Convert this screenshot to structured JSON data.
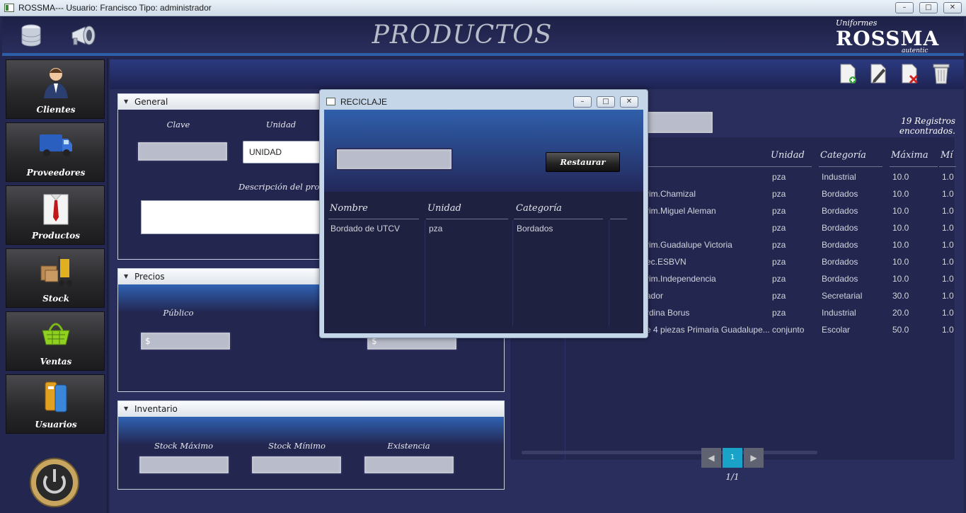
{
  "window": {
    "title": "ROSSMA--- Usuario: Francisco  Tipo: administrador",
    "controls": [
      "–",
      "□",
      "✕"
    ]
  },
  "header": {
    "title": "PRODUCTOS",
    "logo_line1": "Uniformes",
    "logo_line2": "ROSSMA",
    "logo_line3": "autentic"
  },
  "sidebar": {
    "items": [
      {
        "label": "Clientes"
      },
      {
        "label": "Proveedores"
      },
      {
        "label": "Productos"
      },
      {
        "label": "Stock"
      },
      {
        "label": "Ventas"
      },
      {
        "label": "Usuarios"
      }
    ]
  },
  "general": {
    "header": "General",
    "clave_label": "Clave",
    "unidad_label": "Unidad",
    "unidad_value": "UNIDAD",
    "descripcion_label": "Descripción del prod"
  },
  "precios": {
    "header": "Precios",
    "publico_label": "Público",
    "currency_symbol": "$"
  },
  "inventario": {
    "header": "Inventario",
    "stock_max_label": "Stock Máximo",
    "stock_min_label": "Stock Mínimo",
    "existencia_label": "Existencia"
  },
  "results": {
    "count_text": "19 Registros encontrados.",
    "columns": [
      "Unidad",
      "Categoría",
      "Máxima",
      "Mí"
    ],
    "rows": [
      {
        "nombre": "",
        "unidad": "pza",
        "categoria": "Industrial",
        "maxima": "10.0",
        "min": "1.0"
      },
      {
        "nombre": "rim.Chamizal",
        "unidad": "pza",
        "categoria": "Bordados",
        "maxima": "10.0",
        "min": "1.0"
      },
      {
        "nombre": "rim.Miguel Aleman",
        "unidad": "pza",
        "categoria": "Bordados",
        "maxima": "10.0",
        "min": "1.0"
      },
      {
        "nombre": "",
        "unidad": "pza",
        "categoria": "Bordados",
        "maxima": "10.0",
        "min": "1.0"
      },
      {
        "nombre": "rim.Guadalupe Victoria",
        "unidad": "pza",
        "categoria": "Bordados",
        "maxima": "10.0",
        "min": "1.0"
      },
      {
        "nombre": "ec.ESBVN",
        "unidad": "pza",
        "categoria": "Bordados",
        "maxima": "10.0",
        "min": "1.0"
      },
      {
        "nombre": "rim.Independencia",
        "unidad": "pza",
        "categoria": "Bordados",
        "maxima": "10.0",
        "min": "1.0"
      },
      {
        "nombre": "ador",
        "unidad": "pza",
        "categoria": "Secretarial",
        "maxima": "30.0",
        "min": "1.0"
      },
      {
        "nombre": "rdina Borus",
        "unidad": "pza",
        "categoria": "Industrial",
        "maxima": "20.0",
        "min": "1.0"
      },
      {
        "nombre": "e 4 piezas Primaria Guadalupe...",
        "unidad": "conjunto",
        "categoria": "Escolar",
        "maxima": "50.0",
        "min": "1.0"
      }
    ]
  },
  "pager": {
    "prev": "◀",
    "current": "1",
    "next": "▶",
    "info": "1/1"
  },
  "modal": {
    "title": "RECICLAJE",
    "restore_label": "Restaurar",
    "columns": [
      "Nombre",
      "Unidad",
      "Categoría"
    ],
    "rows": [
      {
        "nombre": "Bordado de UTCV",
        "unidad": "pza",
        "categoria": "Bordados"
      }
    ]
  },
  "colors": {
    "background": "#23264f",
    "accent": "#2c5fa7",
    "pager_active": "#1aa3c9"
  }
}
